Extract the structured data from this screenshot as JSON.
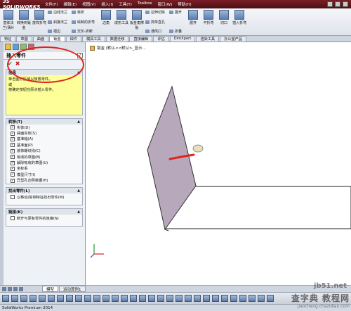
{
  "app": {
    "logo": "3S SOLIDWORKS",
    "menus": [
      "文件(F)",
      "编辑(E)",
      "视图(V)",
      "插入(I)",
      "工具(T)",
      "Toolbox",
      "窗口(W)",
      "帮助(H)"
    ]
  },
  "ribbon": {
    "big_buttons": [
      "基体法兰/薄片",
      "转换到钣金",
      "放样折弯"
    ],
    "column1": [
      "边线法兰",
      "斜接法兰",
      "褶边"
    ],
    "column2": [
      "转折",
      "绘制的折弯",
      "交叉-折断"
    ],
    "big_buttons2": [
      "边角",
      "成形工具",
      "钣金角撑板"
    ],
    "column3": [
      "拉伸切除",
      "简单直孔",
      "通风口"
    ],
    "big_buttons3": [
      "展开",
      "折叠",
      "不折弯",
      "切口",
      "插入折弯"
    ],
    "column4": [
      "展开",
      "折叠"
    ]
  },
  "tabs": [
    "特征",
    "草图",
    "曲面",
    "钣金",
    "焊件",
    "模具工具",
    "数据迁移",
    "直接编辑",
    "评估",
    "DimXpert",
    "渲染工具",
    "办公室产品"
  ],
  "active_tab": "钣金",
  "panel": {
    "title": "插入零件",
    "help": "?",
    "info_title": "信息",
    "info_text": [
      "单击图形区域以放置零件。",
      "或",
      "按确定按钮在原点插入零件。"
    ],
    "transfer_title": "转移(T)",
    "transfer_items": [
      {
        "label": "实体(D)",
        "checked": true
      },
      {
        "label": "曲面实体(S)",
        "checked": true
      },
      {
        "label": "基准轴(A)",
        "checked": true
      },
      {
        "label": "基准面(P)",
        "checked": true
      },
      {
        "label": "装饰螺纹线(C)",
        "checked": true
      },
      {
        "label": "吸收的草图(B)",
        "checked": true
      },
      {
        "label": "解除吸收的草图(U)",
        "checked": true
      },
      {
        "label": "坐标系",
        "checked": true
      },
      {
        "label": "模型尺寸(I)",
        "checked": true
      },
      {
        "label": "异型孔向导数据(H)",
        "checked": true
      }
    ],
    "find_title": "找出零件(L)",
    "find_option": "以移动/复制特征找出零件(M)",
    "link_title": "链接(K)",
    "link_option": "断开与原有零件的连接(N)"
  },
  "viewport": {
    "tree_label": "钣金 (默认<<默认>_显示..."
  },
  "bottom_tabs": [
    "模型",
    "运动算例1"
  ],
  "active_bottom_tab": "模型",
  "status": "SolidWorks Premium 2014",
  "watermark": {
    "main": "查字典 教程网",
    "sub": "jiaocheng.chazidian.com",
    "site": "jb51.net"
  },
  "colors": {
    "annotation": "#e0241c",
    "panel_face": "#b8a8bb",
    "info_bg": "#ffff9a"
  }
}
